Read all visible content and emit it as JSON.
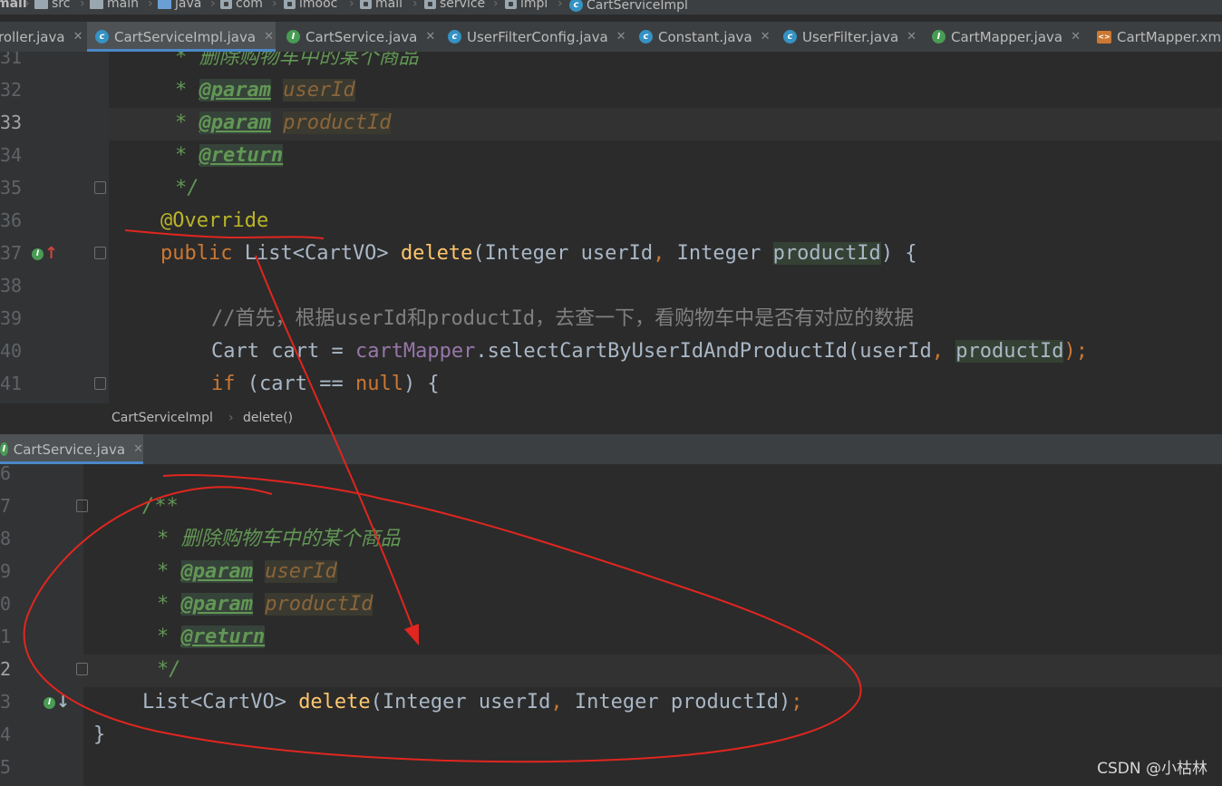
{
  "breadcrumb": [
    "mall",
    "src",
    "main",
    "java",
    "com",
    "imooc",
    "mall",
    "service",
    "impl",
    "CartServiceImpl"
  ],
  "top_tabs": [
    {
      "label": "roller.java",
      "icon": "class-icon"
    },
    {
      "label": "CartServiceImpl.java",
      "icon": "class-icon"
    },
    {
      "label": "CartService.java",
      "icon": "interface-icon"
    },
    {
      "label": "UserFilterConfig.java",
      "icon": "class-icon"
    },
    {
      "label": "Constant.java",
      "icon": "class-icon"
    },
    {
      "label": "UserFilter.java",
      "icon": "class-icon"
    },
    {
      "label": "CartMapper.java",
      "icon": "interface-icon"
    },
    {
      "label": "CartMapper.xm",
      "icon": "xml-icon"
    }
  ],
  "top_editor": {
    "line_numbers": [
      "31",
      "32",
      "33",
      "34",
      "35",
      "36",
      "37",
      "38",
      "39",
      "40",
      "41"
    ],
    "comment_partial": "* 删除购物车中的某个商品",
    "doc_star": "*",
    "param_tag": "@param",
    "return_tag": "@return",
    "param_user": "userId",
    "param_product": "productId",
    "doc_end": "*/",
    "override": "@Override",
    "kw_public": "public",
    "ret_type": "List<CartVO>",
    "method": "delete",
    "open_paren": "(",
    "integer_type": "Integer",
    "user_id": "userId",
    "comma": ",",
    "product_id": "productId",
    "close_brace": ") {",
    "comment_line": "//首先，根据userId和productId，去查一下，看购物车中是否有对应的数据",
    "cart_decl": "Cart cart = ",
    "mapper_field": "cartMapper",
    "mapper_call": ".selectCartByUserIdAndProductId(userId",
    "call_end": ");",
    "kw_if": "if",
    "if_cond": " (cart == ",
    "kw_null": "null",
    "if_end": ") {"
  },
  "editor_breadcrumb": {
    "class": "CartServiceImpl",
    "method": "delete()"
  },
  "bottom_tab": {
    "label": "CartService.java",
    "icon": "interface-icon"
  },
  "bottom_editor": {
    "line_numbers": [
      "6",
      "7",
      "8",
      "9",
      "0",
      "1",
      "2",
      "3",
      "4",
      "5"
    ],
    "doc_start": "/**",
    "comment": "* 删除购物车中的某个商品",
    "doc_star": "*",
    "param_tag": "@param",
    "return_tag": "@return",
    "param_user": "userId",
    "param_product": "productId",
    "doc_end": "*/",
    "ret_type": "List<CartVO> ",
    "method": "delete",
    "params": "(Integer userId",
    "comma": ",",
    "params2": " Integer productId)",
    "semicolon": ";",
    "class_end": "}"
  },
  "watermark": "CSDN @小枯林",
  "colors": {
    "keyword": "#cc7832",
    "annotation": "#bbb529",
    "method": "#ffc66d",
    "doc": "#629755",
    "annotation_stroke": "#e0261f"
  }
}
